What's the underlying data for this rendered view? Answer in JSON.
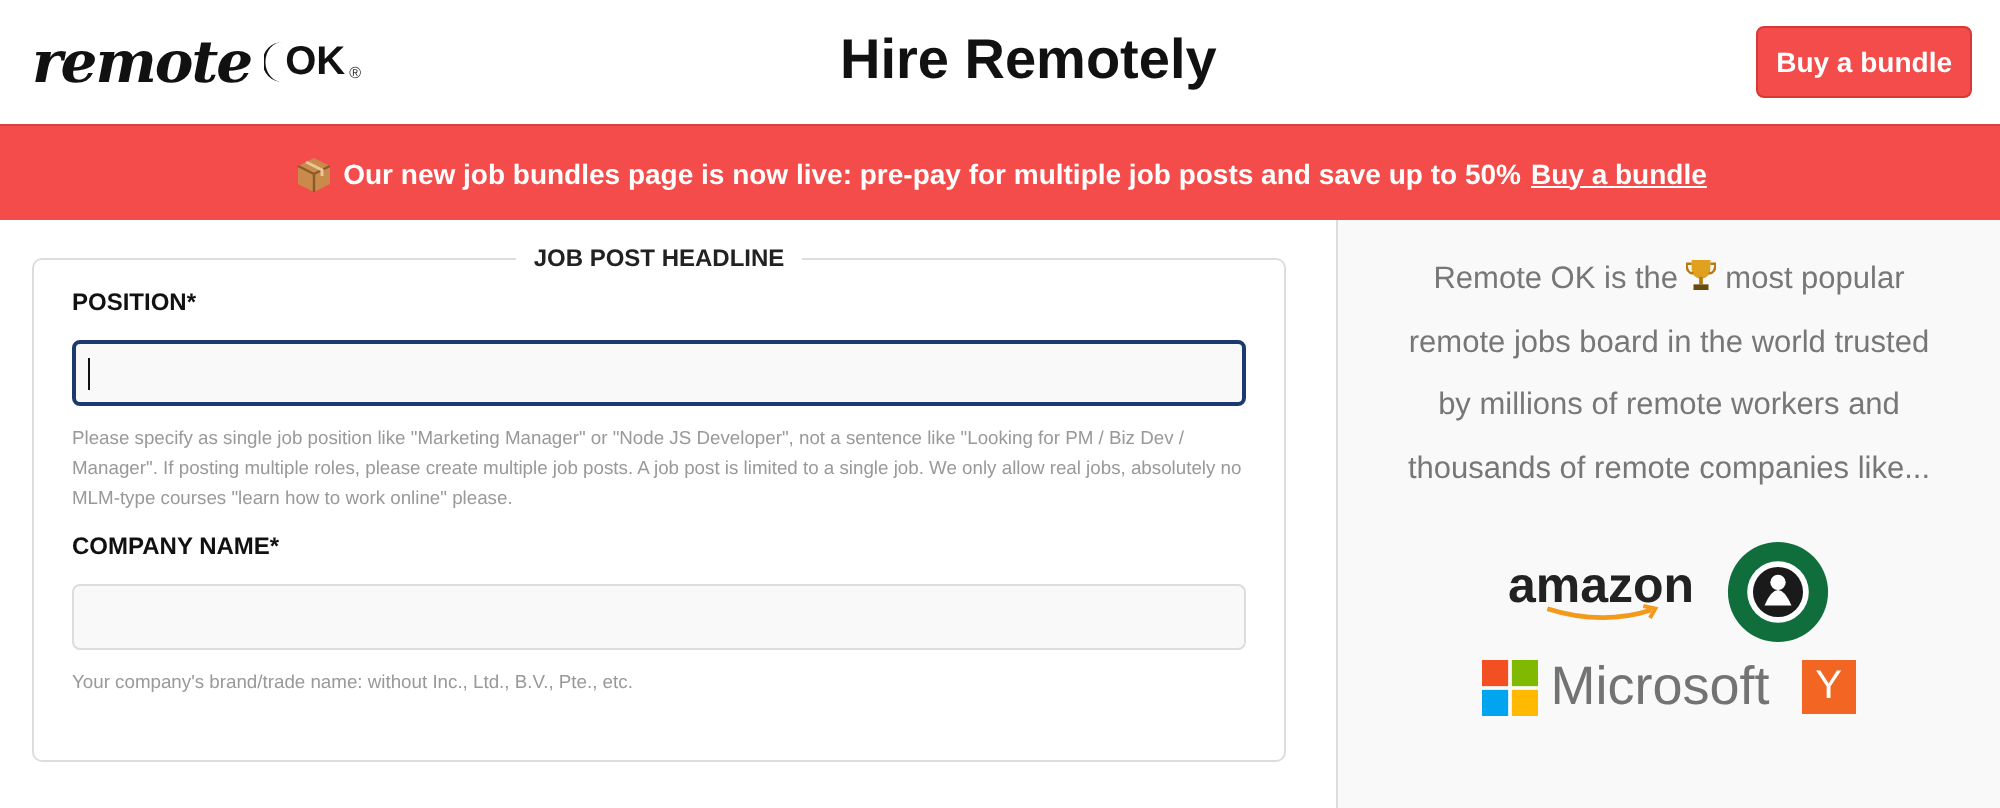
{
  "logo": {
    "word": "remote",
    "mark": "OK",
    "registered": "®"
  },
  "title": "Hire Remotely",
  "header_button": "Buy a bundle",
  "banner": {
    "text": "Our new job bundles page is now live: pre-pay for multiple job posts and save up to 50%",
    "link": "Buy a bundle"
  },
  "form": {
    "legend": "JOB POST HEADLINE",
    "fields": [
      {
        "label": "POSITION*",
        "focused": true,
        "help": "Please specify as single job position like \"Marketing Manager\" or \"Node JS Developer\", not a sentence like \"Looking for PM / Biz Dev / Manager\". If posting multiple roles, please create multiple job posts. A job post is limited to a single job. We only allow real jobs, absolutely no MLM-type courses \"learn how to work online\" please."
      },
      {
        "label": "COMPANY NAME*",
        "focused": false,
        "help": "Your company's brand/trade name: without Inc., Ltd., B.V., Pte., etc."
      }
    ]
  },
  "sidebar": {
    "pitch_before": "Remote OK is the",
    "pitch_after": "most popular remote jobs board in the world trusted by millions of remote workers and thousands of remote companies like...",
    "logos": [
      {
        "kind": "amazon",
        "text": "amazon"
      },
      {
        "kind": "starbucks"
      },
      {
        "kind": "microsoft",
        "text": "Microsoft"
      },
      {
        "kind": "ycombinator",
        "text": "Y"
      }
    ]
  }
}
